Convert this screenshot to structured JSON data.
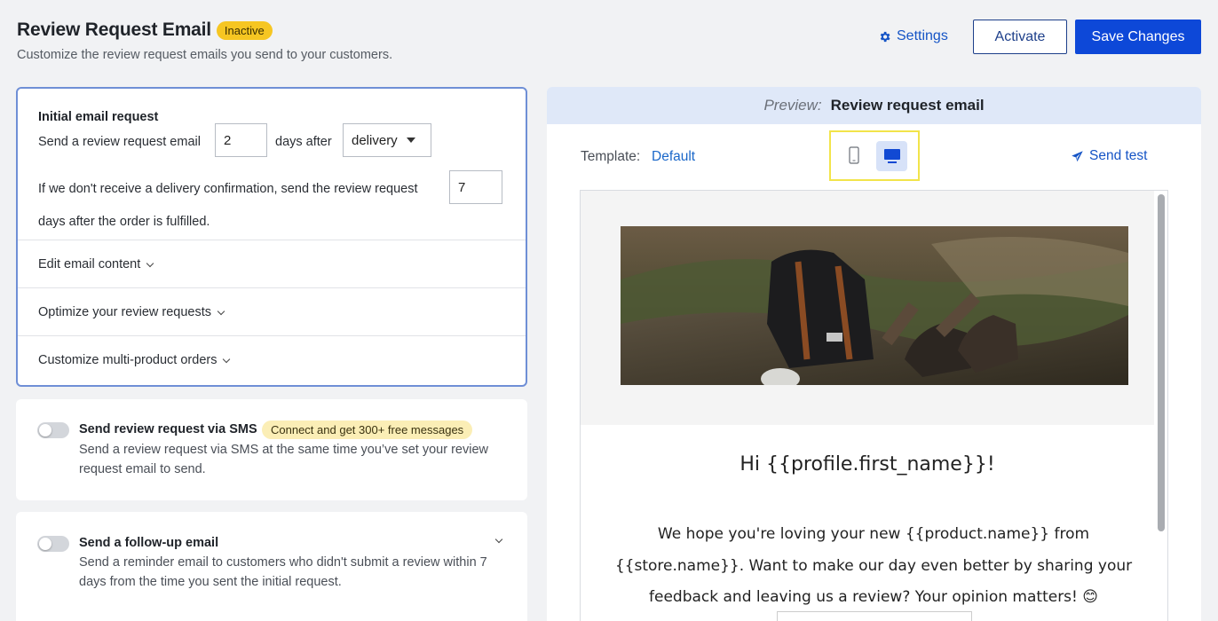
{
  "header": {
    "title": "Review Request Email",
    "status_badge": "Inactive",
    "subtitle": "Customize the review request emails you send to your customers.",
    "settings_label": "Settings",
    "activate_label": "Activate",
    "save_label": "Save Changes"
  },
  "initial_request": {
    "title": "Initial email request",
    "send_prefix": "Send a review request email",
    "days_value": "2",
    "days_after": "days after",
    "trigger_selected": "delivery",
    "fallback_text": "If we don't receive a delivery confirmation, send the review request",
    "fallback_days_value": "7",
    "fallback_suffix": "days after the order is fulfilled.",
    "accordion": [
      {
        "label": "Edit email content"
      },
      {
        "label": "Optimize your review requests"
      },
      {
        "label": "Customize multi-product orders"
      }
    ]
  },
  "sms": {
    "title": "Send review request via SMS",
    "badge": "Connect and get 300+ free messages",
    "description": "Send a review request via SMS at the same time you’ve set your review request email to send."
  },
  "follow_up": {
    "title": "Send a follow-up email",
    "description": "Send a reminder email to customers who didn't submit a review within 7 days from the time you sent the initial request."
  },
  "preview": {
    "label": "Preview:",
    "name": "Review request email",
    "template_label": "Template:",
    "template_value": "Default",
    "send_test_label": "Send test",
    "email": {
      "greeting": "Hi {{profile.first_name}}!",
      "body": "We hope you're loving your new {{product.name}} from {{store.name}}. Want to make our day even better by sharing your feedback and leaving us a review? Your opinion matters! 😊"
    }
  },
  "colors": {
    "primary": "#0d48d8",
    "link": "#1554c6",
    "inactive_badge": "#f6c622",
    "promo_badge": "#fbeeb6",
    "highlight_box": "#f2e44a"
  },
  "icons": {
    "settings": "gear-icon",
    "send_test": "paper-plane-icon",
    "mobile": "mobile-icon",
    "desktop": "desktop-icon"
  }
}
